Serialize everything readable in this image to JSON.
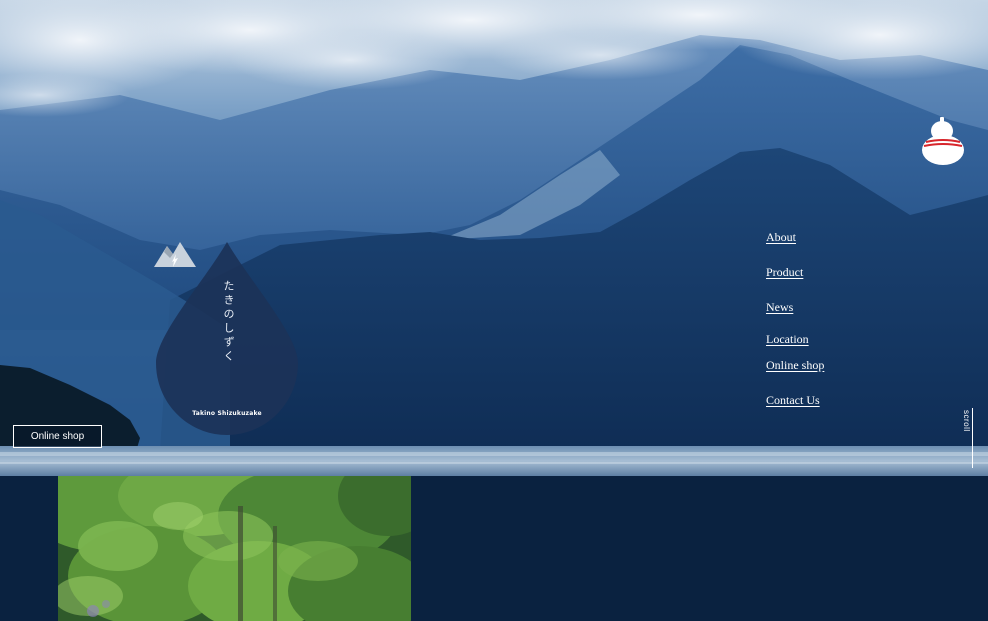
{
  "brand": {
    "vertical_name": "たきのしずく",
    "name": "Takino Shizukuzake"
  },
  "hero": {
    "online_shop_label": "Online shop",
    "scroll_label": "scroll"
  },
  "nav": {
    "items": [
      {
        "label": "About"
      },
      {
        "label": "Product"
      },
      {
        "label": "News"
      },
      {
        "label": "Location"
      },
      {
        "label": "Online shop"
      },
      {
        "label": "Contact Us"
      }
    ]
  },
  "icons": {
    "logo": "water-drop-logo",
    "menu": "gourd-icon",
    "brand_mark": "mountain-icon"
  },
  "colors": {
    "background": "#0a2240",
    "drop": "#1c3358",
    "gourd_band": "#d7262c",
    "text": "#ffffff"
  }
}
